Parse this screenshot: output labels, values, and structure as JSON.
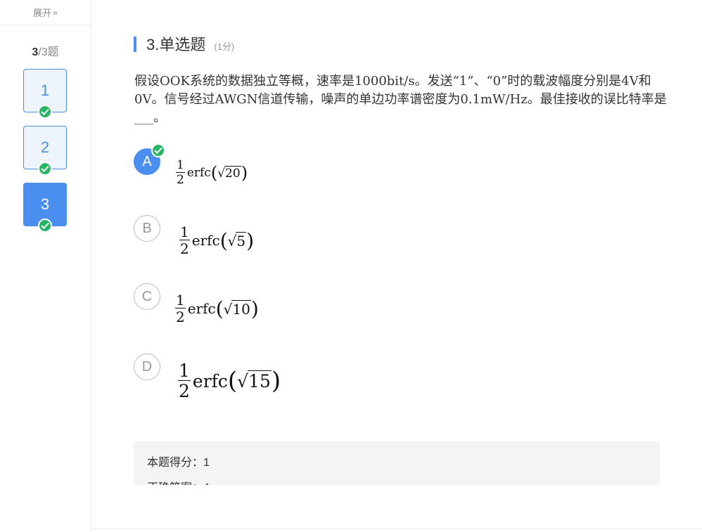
{
  "sidebar": {
    "expand_label": "展开",
    "expand_icon": "»",
    "progress_current": "3",
    "progress_rest": "/3题",
    "questions": [
      {
        "number": "1",
        "answered": true,
        "active": false
      },
      {
        "number": "2",
        "answered": true,
        "active": false
      },
      {
        "number": "3",
        "answered": true,
        "active": true
      }
    ]
  },
  "question": {
    "title": "3.单选题",
    "score": "(1分)",
    "stem": "假设OOK系统的数据独立等概，速率是1000bit/s。发送“1”、“0”时的载波幅度分别是4V和0V。信号经过AWGN信道传输，噪声的单边功率谱密度为0.1mW/Hz。最佳接收的误比特率是___。"
  },
  "options": [
    {
      "letter": "A",
      "numerator": "1",
      "denominator": "2",
      "func": "erfc",
      "radicand": "20",
      "selected": true
    },
    {
      "letter": "B",
      "numerator": "1",
      "denominator": "2",
      "func": "erfc",
      "radicand": "5",
      "selected": false
    },
    {
      "letter": "C",
      "numerator": "1",
      "denominator": "2",
      "func": "erfc",
      "radicand": "10",
      "selected": false
    },
    {
      "letter": "D",
      "numerator": "1",
      "denominator": "2",
      "func": "erfc",
      "radicand": "15",
      "selected": false
    }
  ],
  "result": {
    "score_line": "本题得分：1",
    "answer_line": "正确答案：A"
  },
  "colors": {
    "accent": "#4a8ef0",
    "success": "#25b565"
  }
}
